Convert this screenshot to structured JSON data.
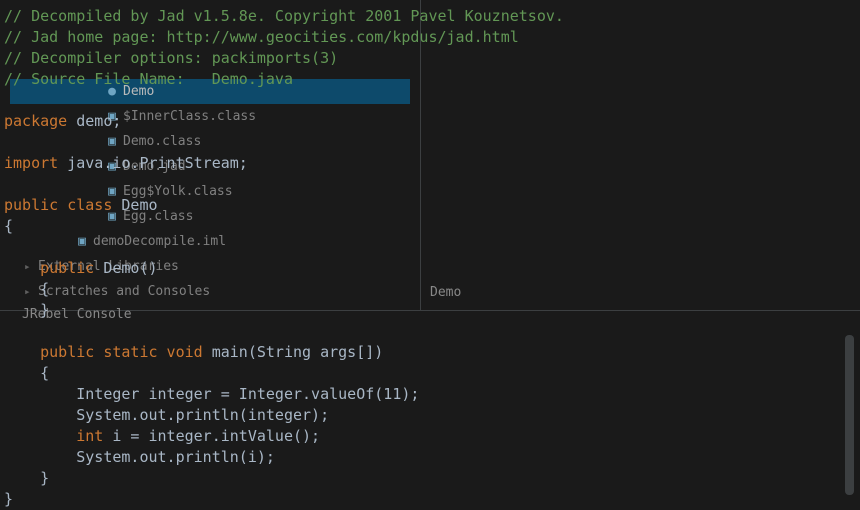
{
  "tree": {
    "items": [
      {
        "depth": 0,
        "icon": "",
        "label": ""
      },
      {
        "depth": 1,
        "icon": "",
        "label": ""
      },
      {
        "depth": 2,
        "icon": "●",
        "label": "Demo",
        "selected": true
      },
      {
        "depth": 2,
        "icon": "▣",
        "label": "$InnerClass.class"
      },
      {
        "depth": 2,
        "icon": "▣",
        "label": "Demo.class"
      },
      {
        "depth": 2,
        "icon": "▣",
        "label": "Demo.jad"
      },
      {
        "depth": 2,
        "icon": "▣",
        "label": "Egg$Yolk.class"
      },
      {
        "depth": 2,
        "icon": "▣",
        "label": "Egg.class"
      },
      {
        "depth": 3,
        "icon": "▣",
        "label": "demoDecompile.iml"
      },
      {
        "depth": 0,
        "icon": "▸",
        "label": "External Libraries"
      },
      {
        "depth": 0,
        "icon": "▸",
        "label": "Scratches and Consoles"
      }
    ]
  },
  "side_tab": "JRebel Console",
  "preview_label": "Demo",
  "code": {
    "l1": "// Decompiled by Jad v1.5.8e. Copyright 2001 Pavel Kouznetsov.",
    "l2": "// Jad home page: http://www.geocities.com/kpdus/jad.html",
    "l3": "// Decompiler options: packimports(3) ",
    "l4": "// Source File Name:   Demo.java",
    "l5": "",
    "l6_kw": "package",
    "l6_rest": " demo;",
    "l7": "",
    "l8_kw": "import",
    "l8_rest": " java.io.PrintStream;",
    "l9": "",
    "l10_kw": "public class",
    "l10_rest": " Demo",
    "l11": "{",
    "l12": "",
    "l13_kw": "    public",
    "l13_rest": " Demo()",
    "l14": "    {",
    "l15": "    }",
    "l16": "",
    "l17_kw": "    public static void",
    "l17_rest": " main(String args[])",
    "l18": "    {",
    "l19": "        Integer integer = Integer.valueOf(11);",
    "l20": "        System.out.println(integer);",
    "l21_a": "        ",
    "l21_kw": "int",
    "l21_b": " i = integer.intValue();",
    "l22": "        System.out.println(i);",
    "l23": "    }",
    "l24": "}"
  }
}
